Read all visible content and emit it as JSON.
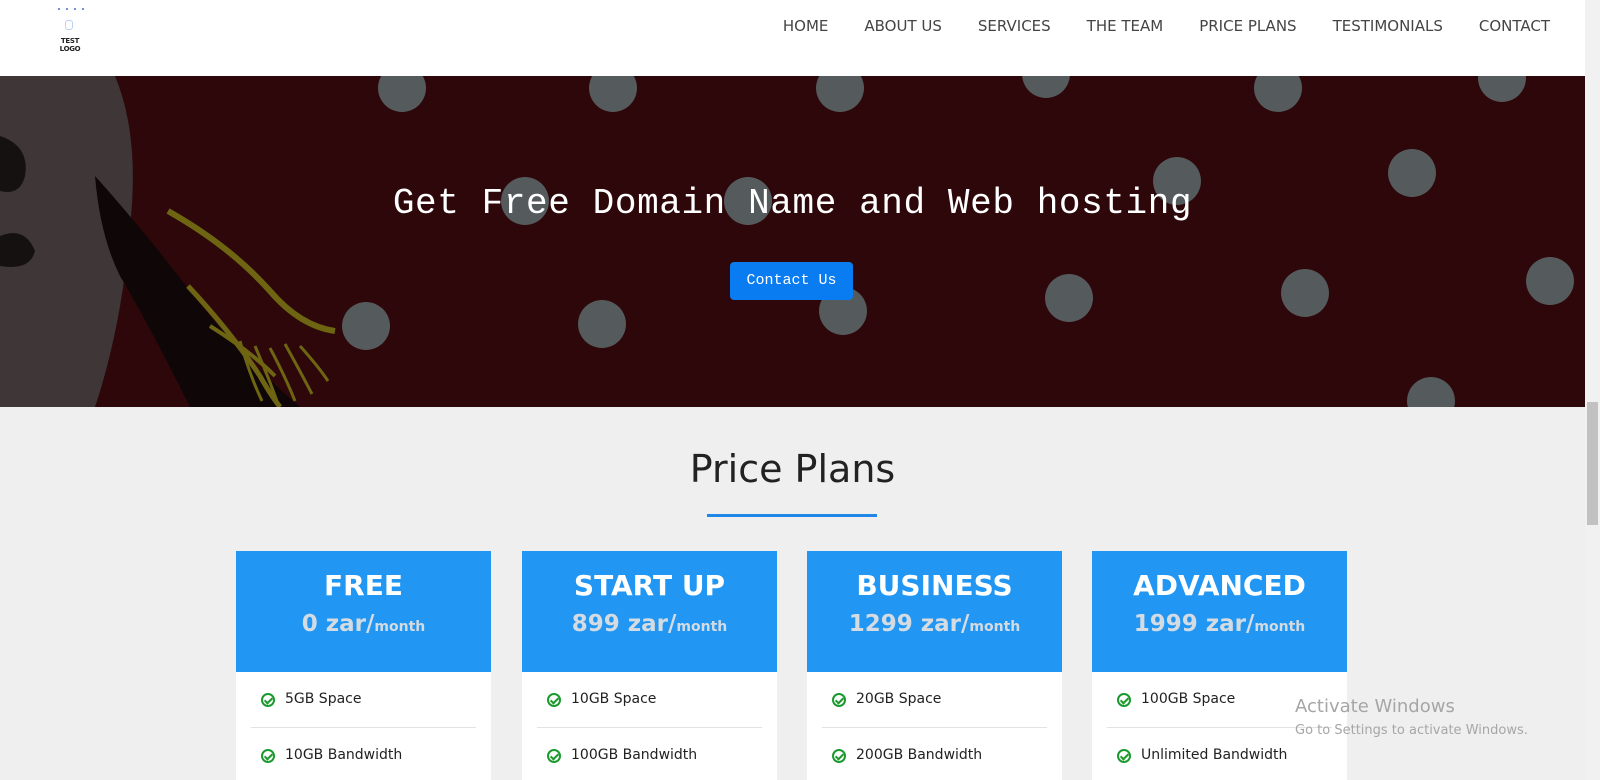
{
  "nav": {
    "logo_text": "TEST LOGO",
    "links": [
      "HOME",
      "ABOUT US",
      "SERVICES",
      "THE TEAM",
      "PRICE PLANS",
      "TESTIMONIALS",
      "CONTACT"
    ]
  },
  "hero": {
    "title": "Get Free Domain Name and Web hosting",
    "button": "Contact Us"
  },
  "pricing": {
    "title": "Price Plans",
    "plans": [
      {
        "name": "FREE",
        "price": "0 zar/",
        "unit": "month",
        "features": [
          "5GB Space",
          "10GB Bandwidth"
        ]
      },
      {
        "name": "START UP",
        "price": "899 zar/",
        "unit": "month",
        "features": [
          "10GB Space",
          "100GB Bandwidth"
        ]
      },
      {
        "name": "BUSINESS",
        "price": "1299 zar/",
        "unit": "month",
        "features": [
          "20GB Space",
          "200GB Bandwidth"
        ]
      },
      {
        "name": "ADVANCED",
        "price": "1999 zar/",
        "unit": "month",
        "features": [
          "100GB Space",
          "Unlimited Bandwidth"
        ]
      }
    ]
  },
  "watermark": {
    "title": "Activate Windows",
    "subtitle": "Go to Settings to activate Windows."
  },
  "colors": {
    "plan_header": "#2196f3",
    "accent": "#0a7cf2",
    "hero_bg": "#2e070a",
    "check": "#1b9a2e"
  }
}
